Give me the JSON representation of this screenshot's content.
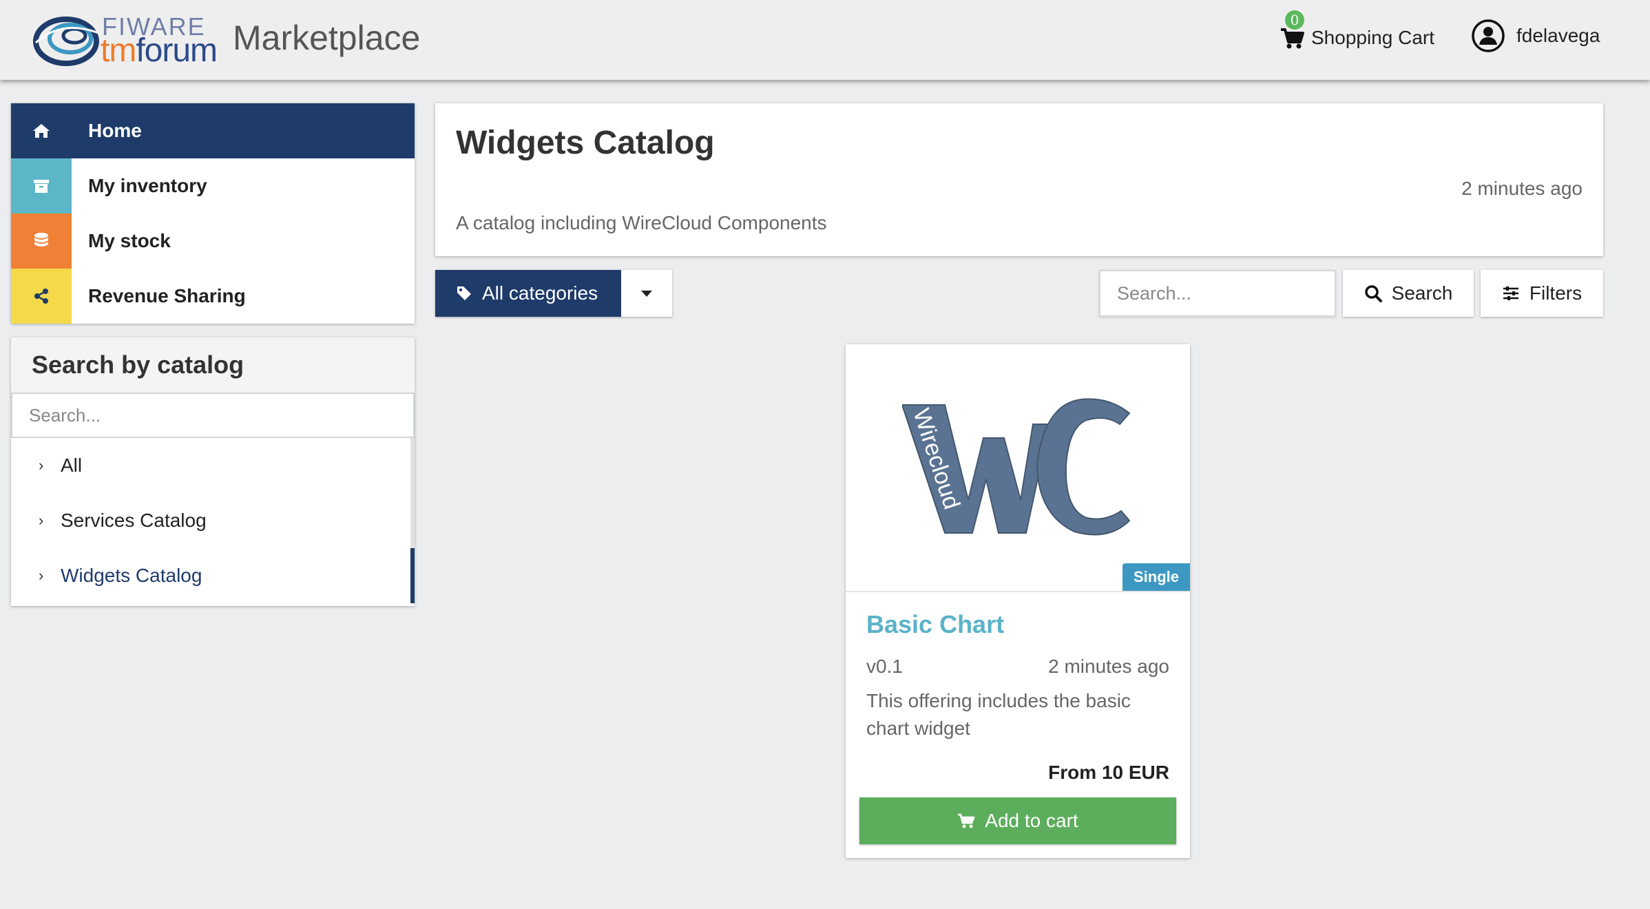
{
  "header": {
    "logo_top": "FIWARE",
    "logo_bottom_tm": "tm",
    "logo_bottom_rest": "forum",
    "brand": "Marketplace",
    "cart_count": "0",
    "cart_label": "Shopping Cart",
    "username": "fdelavega"
  },
  "sidebar": {
    "items": [
      {
        "label": "Home",
        "icon": "home-icon",
        "color": "#1f3b6a"
      },
      {
        "label": "My inventory",
        "icon": "archive-icon",
        "color": "#5bb7c8"
      },
      {
        "label": "My stock",
        "icon": "database-icon",
        "color": "#ef8035"
      },
      {
        "label": "Revenue Sharing",
        "icon": "share-icon",
        "color": "#f5d94a"
      }
    ]
  },
  "catalog_search": {
    "heading": "Search by catalog",
    "placeholder": "Search...",
    "items": [
      "All",
      "Services Catalog",
      "Widgets Catalog"
    ]
  },
  "catalog": {
    "title": "Widgets Catalog",
    "updated": "2 minutes ago",
    "description": "A catalog including WireCloud Components"
  },
  "toolbar": {
    "categories_label": "All categories",
    "search_placeholder": "Search...",
    "search_label": "Search",
    "filters_label": "Filters"
  },
  "offering": {
    "image_text": "Wirecloud",
    "badge": "Single",
    "name": "Basic Chart",
    "version": "v0.1",
    "updated": "2 minutes ago",
    "description": "This offering includes the basic chart widget",
    "price": "From 10 EUR",
    "add_to_cart": "Add to cart"
  },
  "colors": {
    "primary": "#1f3b6a",
    "accent_green": "#5cad5c",
    "badge_blue": "#3c98c2",
    "link_teal": "#5bb2c8"
  }
}
